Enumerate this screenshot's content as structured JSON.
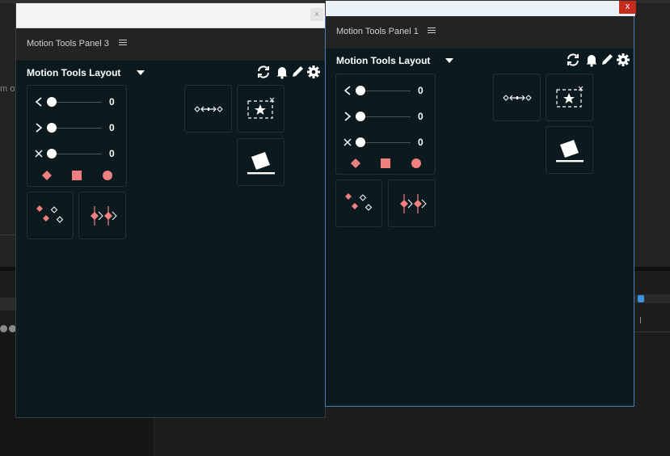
{
  "background": {
    "fragment_text": "m o"
  },
  "panels": [
    {
      "id": "panel3",
      "title": "Motion Tools Panel 3",
      "close_glyph": "×",
      "layout_title": "Motion Tools Layout",
      "sliders": [
        {
          "icon": "chevron-left-icon",
          "value": "0"
        },
        {
          "icon": "chevron-right-icon",
          "value": "0"
        },
        {
          "icon": "cross-icon",
          "value": "0"
        }
      ]
    },
    {
      "id": "panel1",
      "title": "Motion Tools Panel 1",
      "close_glyph": "x",
      "layout_title": "Motion Tools Layout",
      "sliders": [
        {
          "icon": "chevron-left-icon",
          "value": "0"
        },
        {
          "icon": "chevron-right-icon",
          "value": "0"
        },
        {
          "icon": "cross-icon",
          "value": "0"
        }
      ]
    }
  ],
  "colors": {
    "panel_bg": "#0b1a1f",
    "accent_pink": "#f08080",
    "active_border": "#4a7fb5",
    "close_red": "#c42b1c"
  },
  "icons": [
    "sync-icon",
    "bell-icon",
    "pencil-icon",
    "gear-icon",
    "diamond-distribute-icon",
    "star-selection-icon",
    "tilted-square-icon",
    "scatter-keyframes-icon",
    "keyframe-markers-icon"
  ]
}
